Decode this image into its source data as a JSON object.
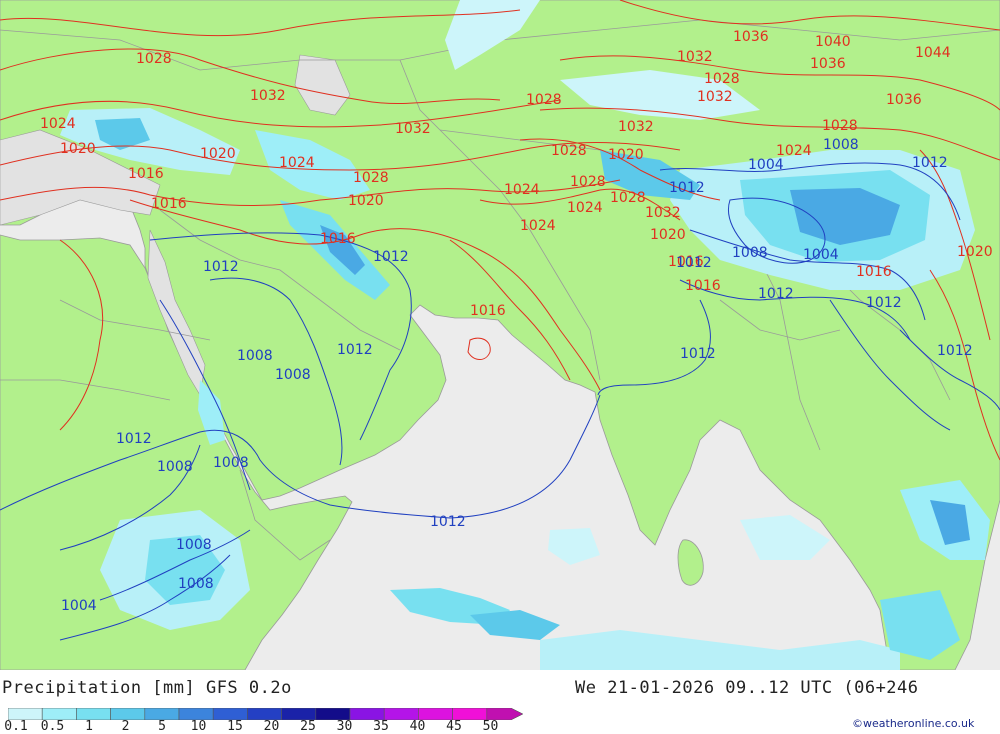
{
  "footer": {
    "title": "Precipitation [mm] GFS 0.2o",
    "datetime": "We 21-01-2026 09..12 UTC (06+246",
    "credit": "©weatheronline.co.uk"
  },
  "legend": {
    "ticks": [
      "0.1",
      "0.5",
      "1",
      "2",
      "5",
      "10",
      "15",
      "20",
      "25",
      "30",
      "35",
      "40",
      "45",
      "50"
    ],
    "colors": [
      "#cdf5fa",
      "#9eeef8",
      "#78e0f0",
      "#5cc9ea",
      "#4aa9e4",
      "#3c84dc",
      "#2f5fd4",
      "#2440c4",
      "#1a22a8",
      "#130c8a",
      "#8a14e4",
      "#b414e8",
      "#dc12e0",
      "#f010d8",
      "#c010b0"
    ]
  },
  "map": {
    "colors": {
      "land": "#b2f08c",
      "sea": "#ececec",
      "land_outside": "#e2e2e2",
      "isobar_high": "#e03020",
      "isobar_low": "#2040c0",
      "border": "#9a9a9a",
      "precip_light": "#b8f0f8",
      "precip_mid": "#78d8f0",
      "precip_heavy": "#4aa9e4"
    },
    "isobar_labels_red": [
      "1028",
      "1032",
      "1036",
      "1040",
      "1044",
      "1032",
      "1036",
      "1028",
      "1032",
      "1036",
      "1028",
      "1032",
      "1032",
      "1028",
      "1024",
      "1020",
      "1020",
      "1024",
      "1028",
      "1016",
      "1016",
      "1020",
      "1016",
      "1028",
      "1020",
      "1024",
      "1024",
      "1028",
      "1032",
      "1024",
      "1020",
      "1028",
      "1024",
      "1016",
      "1016",
      "1016",
      "1020",
      "1016"
    ],
    "isobar_labels_blue": [
      "1012",
      "1012",
      "1008",
      "1008",
      "1012",
      "1012",
      "1008",
      "1008",
      "1008",
      "1008",
      "1004",
      "1012",
      "1012",
      "1004",
      "1012",
      "1008",
      "1004",
      "1012",
      "1012",
      "1012",
      "1012",
      "1008",
      "1012"
    ]
  }
}
